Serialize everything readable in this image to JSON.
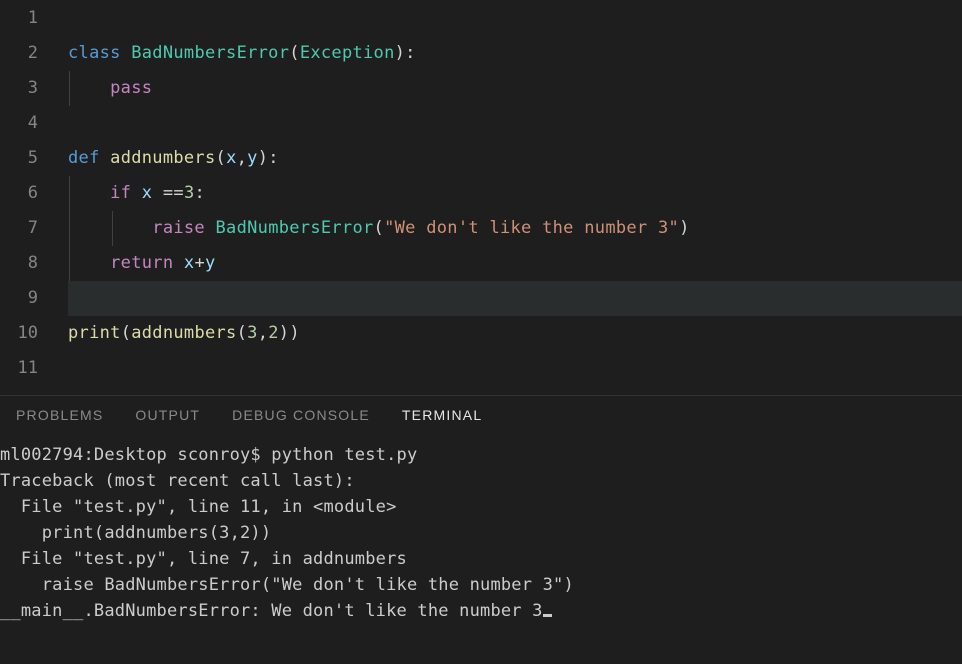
{
  "editor": {
    "gutter": [
      "1",
      "2",
      "3",
      "4",
      "5",
      "6",
      "7",
      "8",
      "9",
      "10",
      "11"
    ],
    "highlighted_line": 9,
    "line2_class": "class",
    "line2_name": "BadNumbersError",
    "line2_base": "Exception",
    "line3_pass": "pass",
    "line5_def": "def",
    "line5_fn": "addnumbers",
    "line5_p1": "x",
    "line5_p2": "y",
    "line6_if": "if",
    "line6_var": "x",
    "line6_op": "==",
    "line6_num": "3",
    "line7_raise": "raise",
    "line7_cls": "BadNumbersError",
    "line7_str": "\"We don't like the number 3\"",
    "line8_return": "return",
    "line8_expr_a": "x",
    "line8_expr_b": "y",
    "line10_print": "print",
    "line10_fn": "addnumbers",
    "line10_a": "3",
    "line10_b": "2"
  },
  "panel": {
    "tabs": {
      "problems": "PROBLEMS",
      "output": "OUTPUT",
      "debug": "DEBUG CONSOLE",
      "terminal": "TERMINAL"
    }
  },
  "terminal": {
    "l1": "ml002794:Desktop sconroy$ python test.py",
    "l2": "Traceback (most recent call last):",
    "l3": "  File \"test.py\", line 11, in <module>",
    "l4": "    print(addnumbers(3,2))",
    "l5": "  File \"test.py\", line 7, in addnumbers",
    "l6": "    raise BadNumbersError(\"We don't like the number 3\")",
    "l7": "__main__.BadNumbersError: We don't like the number 3"
  }
}
